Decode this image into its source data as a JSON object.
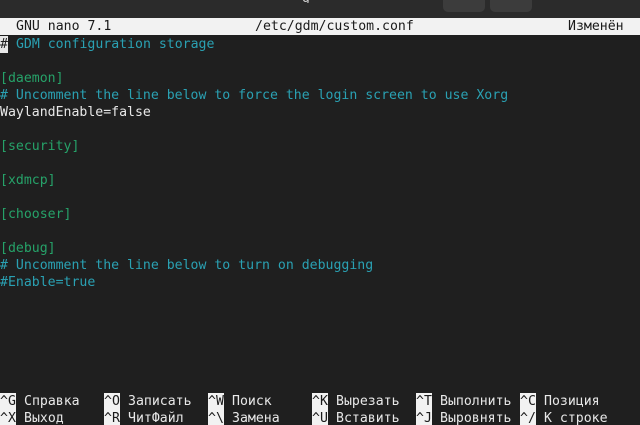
{
  "window": {
    "title_fragment": "g"
  },
  "status": {
    "app": "GNU nano 7.1",
    "file": "/etc/gdm/custom.conf",
    "modified": "Изменён"
  },
  "editor": {
    "lines": [
      {
        "text": " GDM configuration storage",
        "kind": "comment",
        "cursor_char": "#"
      },
      {
        "text": "",
        "kind": "normal"
      },
      {
        "text": "[daemon]",
        "kind": "section"
      },
      {
        "text": "# Uncomment the line below to force the login screen to use Xorg",
        "kind": "comment"
      },
      {
        "text": "WaylandEnable=false",
        "kind": "normal"
      },
      {
        "text": "",
        "kind": "normal"
      },
      {
        "text": "[security]",
        "kind": "section"
      },
      {
        "text": "",
        "kind": "normal"
      },
      {
        "text": "[xdmcp]",
        "kind": "section"
      },
      {
        "text": "",
        "kind": "normal"
      },
      {
        "text": "[chooser]",
        "kind": "section"
      },
      {
        "text": "",
        "kind": "normal"
      },
      {
        "text": "[debug]",
        "kind": "section"
      },
      {
        "text": "# Uncomment the line below to turn on debugging",
        "kind": "comment"
      },
      {
        "text": "#Enable=true",
        "kind": "comment"
      }
    ]
  },
  "shortcuts": {
    "row1": [
      {
        "key": "^G",
        "label": "Справка"
      },
      {
        "key": "^O",
        "label": "Записать"
      },
      {
        "key": "^W",
        "label": "Поиск"
      },
      {
        "key": "^K",
        "label": "Вырезать"
      },
      {
        "key": "^T",
        "label": "Выполнить"
      },
      {
        "key": "^C",
        "label": "Позиция"
      }
    ],
    "row2": [
      {
        "key": "^X",
        "label": "Выход"
      },
      {
        "key": "^R",
        "label": "ЧитФайл"
      },
      {
        "key": "^\\",
        "label": "Замена"
      },
      {
        "key": "^U",
        "label": "Вставить"
      },
      {
        "key": "^J",
        "label": "Выровнять"
      },
      {
        "key": "^/",
        "label": "К строке"
      }
    ]
  },
  "colors": {
    "background": "#1f1f1f",
    "statusbar": "#f2f2f2",
    "comment": "#2aa1b3",
    "section": "#26a269",
    "text": "#e8e8e8"
  }
}
